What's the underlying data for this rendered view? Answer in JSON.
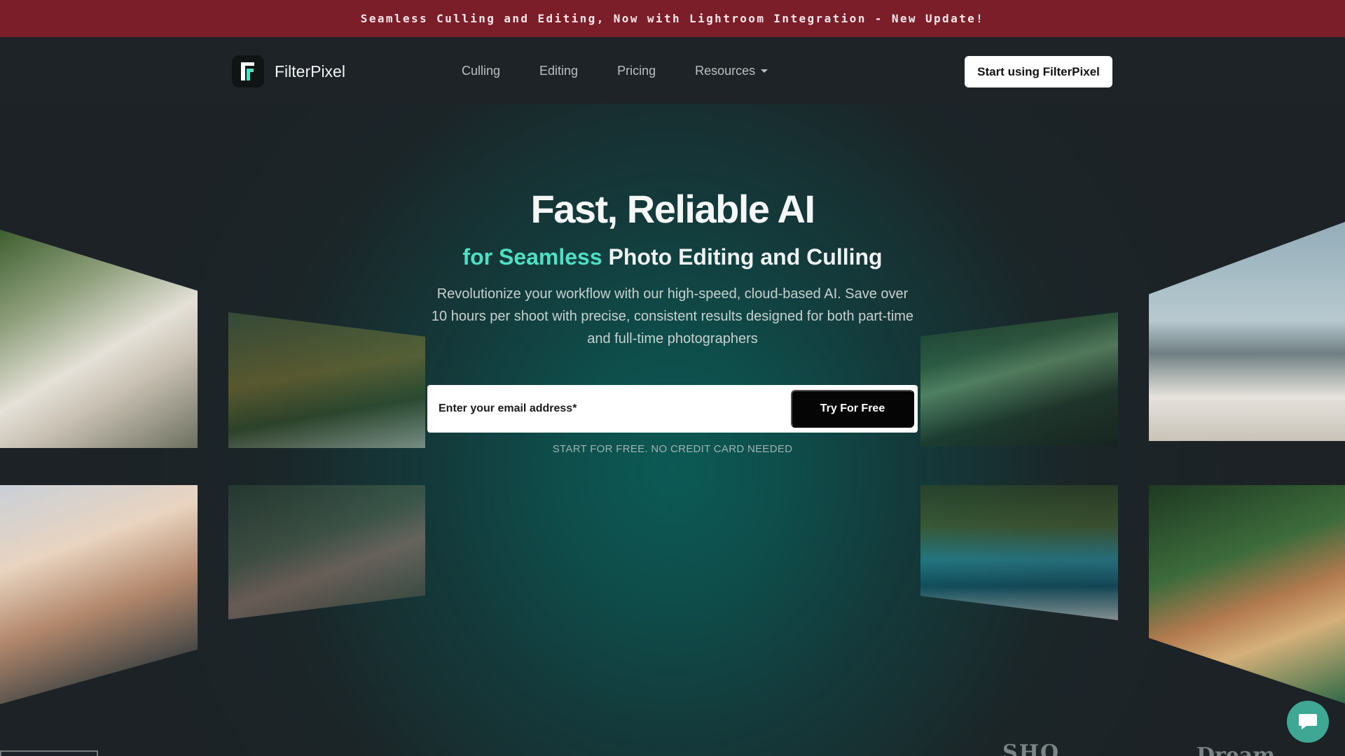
{
  "announcement": {
    "text": "Seamless Culling and Editing, Now with Lightroom Integration - New Update!"
  },
  "nav": {
    "brand": "FilterPixel",
    "links": [
      {
        "label": "Culling"
      },
      {
        "label": "Editing"
      },
      {
        "label": "Pricing"
      },
      {
        "label": "Resources"
      }
    ],
    "cta_label": "Start using FilterPixel"
  },
  "hero": {
    "headline": "Fast, Reliable AI",
    "subhead_accent": "for Seamless",
    "subhead_rest": " Photo Editing and Culling",
    "description": "Revolutionize your workflow with our high-speed, cloud-based AI. Save over 10 hours per shoot with precise, consistent results designed for both part-time and full-time photographers",
    "email_placeholder": "Enter your email address*",
    "submit_label": "Try For Free",
    "note": "START FOR FREE. NO CREDIT CARD NEEDED"
  },
  "logo_strip": {
    "items": [
      "SHQ",
      "Dream"
    ]
  },
  "colors": {
    "announcement_bg": "#7b1e2a",
    "accent": "#4ee0c2",
    "chat_button": "#3fa895"
  },
  "icons": {
    "brand": "filterpixel-logo-icon",
    "resources": "chevron-down-icon",
    "chat": "chat-bubble-icon"
  }
}
